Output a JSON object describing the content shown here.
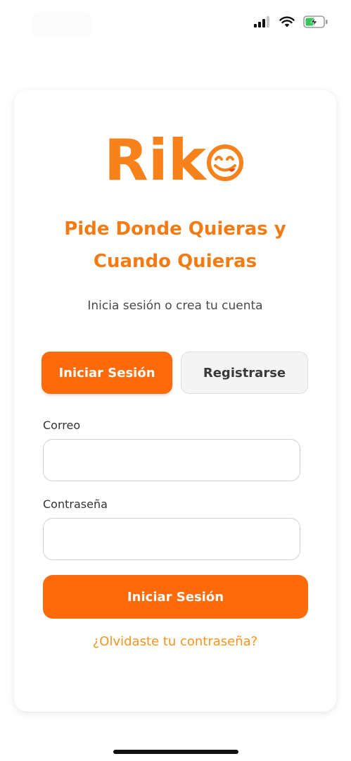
{
  "brand": {
    "name": "Riko",
    "accent_color": "#ff6b0a",
    "headline_color": "#f47b14",
    "link_color": "#f7931e"
  },
  "status_bar": {
    "icons": [
      "cellular-signal-icon",
      "wifi-icon",
      "battery-charging-icon"
    ]
  },
  "header": {
    "headline_line1": "Pide Donde Quieras y",
    "headline_line2": "Cuando Quieras",
    "subtitle": "Inicia sesión o crea tu cuenta"
  },
  "tabs": {
    "login": "Iniciar Sesión",
    "register": "Registrarse",
    "active": "login"
  },
  "form": {
    "email_label": "Correo",
    "email_value": "",
    "password_label": "Contraseña",
    "password_value": "",
    "submit_label": "Iniciar Sesión",
    "forgot_label": "¿Olvidaste tu contraseña?"
  }
}
